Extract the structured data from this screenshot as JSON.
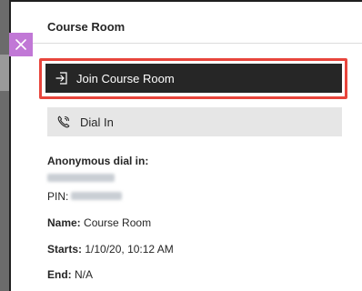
{
  "panel": {
    "title": "Course Room"
  },
  "actions": {
    "join_label": "Join Course Room",
    "dial_label": "Dial In"
  },
  "details": {
    "anonymous_label": "Anonymous dial in:",
    "pin_label": "PIN:",
    "name_label": "Name:",
    "name_value": "Course Room",
    "starts_label": "Starts:",
    "starts_value": "1/10/20, 10:12 AM",
    "end_label": "End:",
    "end_value": "N/A"
  },
  "colors": {
    "close_button": "#c178d6",
    "highlight": "#e8453c",
    "join_button": "#262626",
    "dial_button": "#e6e6e6"
  },
  "icons": {
    "close": "close-icon",
    "join": "enter-icon",
    "dial": "phone-icon"
  }
}
